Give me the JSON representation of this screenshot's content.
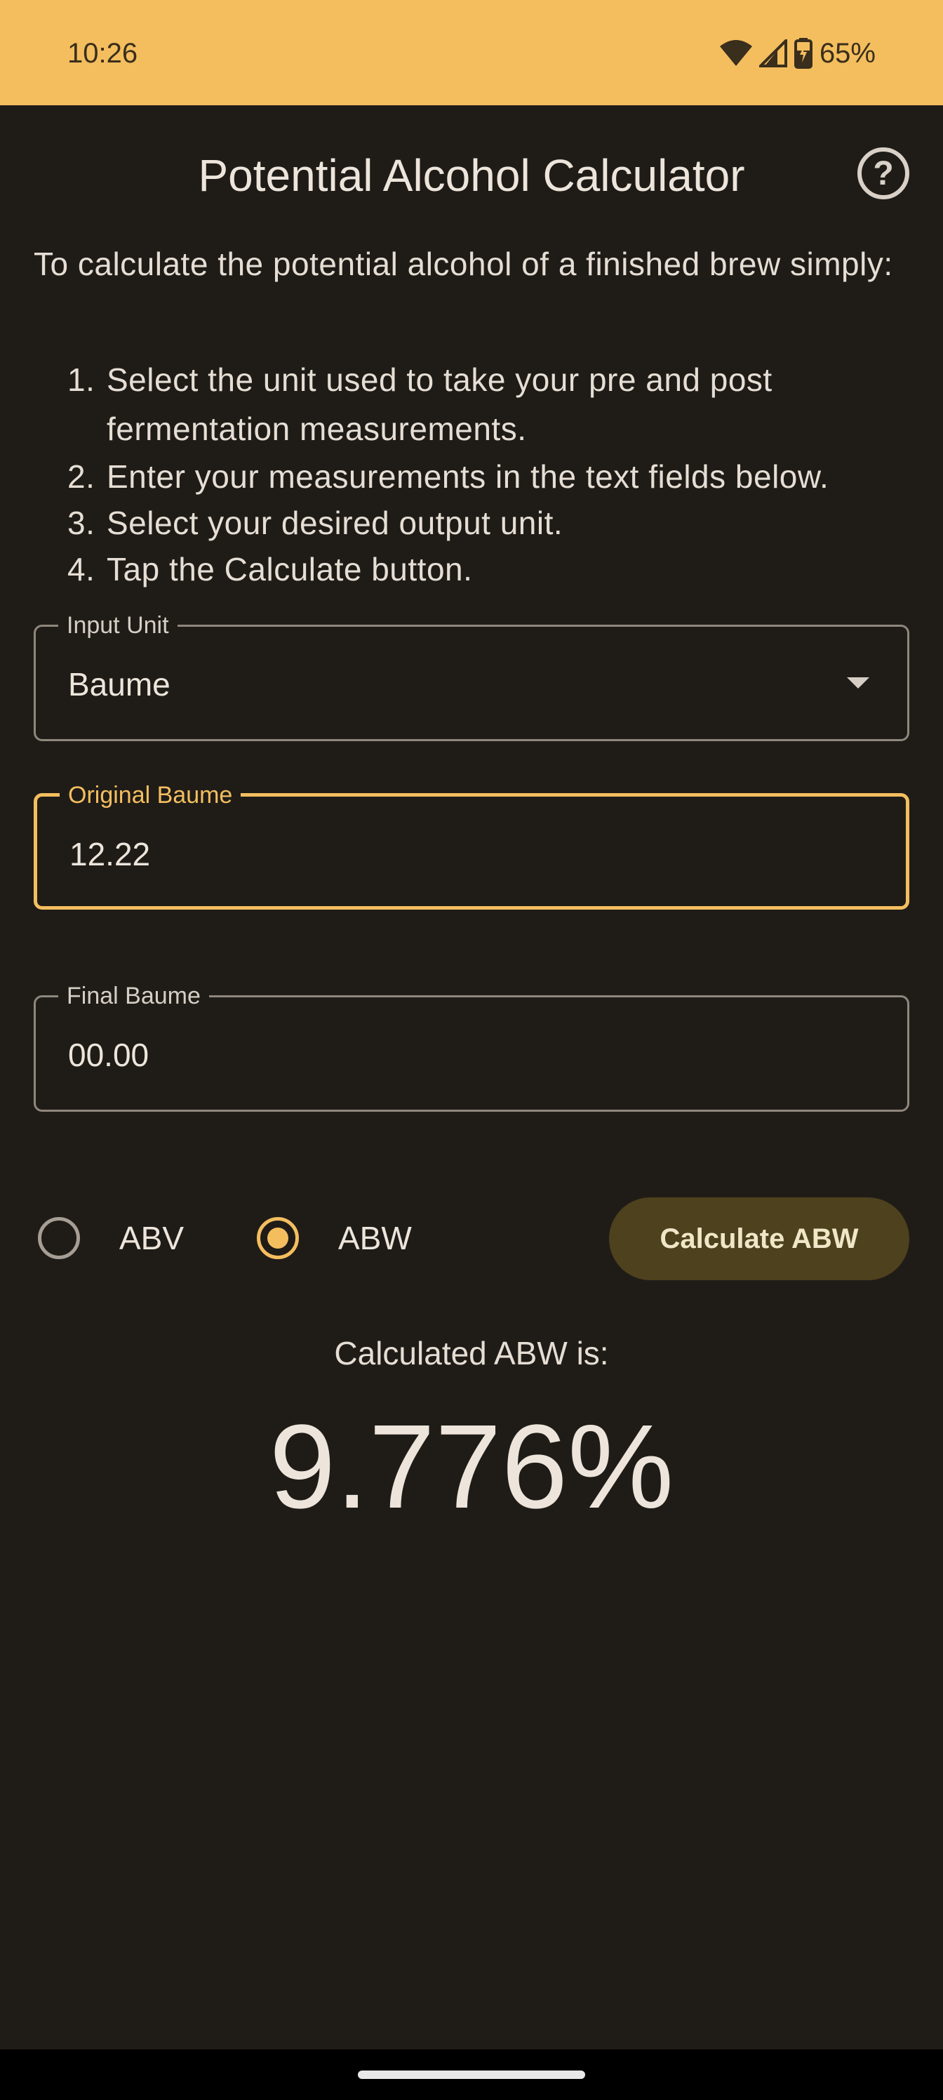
{
  "status": {
    "time": "10:26",
    "battery_pct": "65%",
    "icons": [
      "wifi-icon",
      "cell-signal-icon",
      "battery-charging-icon"
    ]
  },
  "header": {
    "title": "Potential Alcohol Calculator",
    "help_icon": "?"
  },
  "intro": {
    "text": "To calculate the potential alcohol of a finished brew simply:",
    "steps": [
      {
        "num": "1.",
        "text": "Select the unit used to take your pre and post fermentation measurements."
      },
      {
        "num": "2.",
        "text": "Enter your measurements in the text fields below."
      },
      {
        "num": "3.",
        "text": "Select your desired output unit."
      },
      {
        "num": "4.",
        "text": "Tap the Calculate button."
      }
    ]
  },
  "input_unit": {
    "label": "Input Unit",
    "value": "Baume"
  },
  "original": {
    "label": "Original Baume",
    "value": "12.22"
  },
  "final": {
    "label": "Final Baume",
    "value": "00.00"
  },
  "output_unit": {
    "options": [
      {
        "label": "ABV",
        "selected": false
      },
      {
        "label": "ABW",
        "selected": true
      }
    ]
  },
  "calculate_button": "Calculate ABW",
  "result": {
    "label": "Calculated ABW is:",
    "value": "9.776%"
  },
  "colors": {
    "accent": "#f4be5f",
    "background": "#1f1c18",
    "button": "#4e411d"
  }
}
